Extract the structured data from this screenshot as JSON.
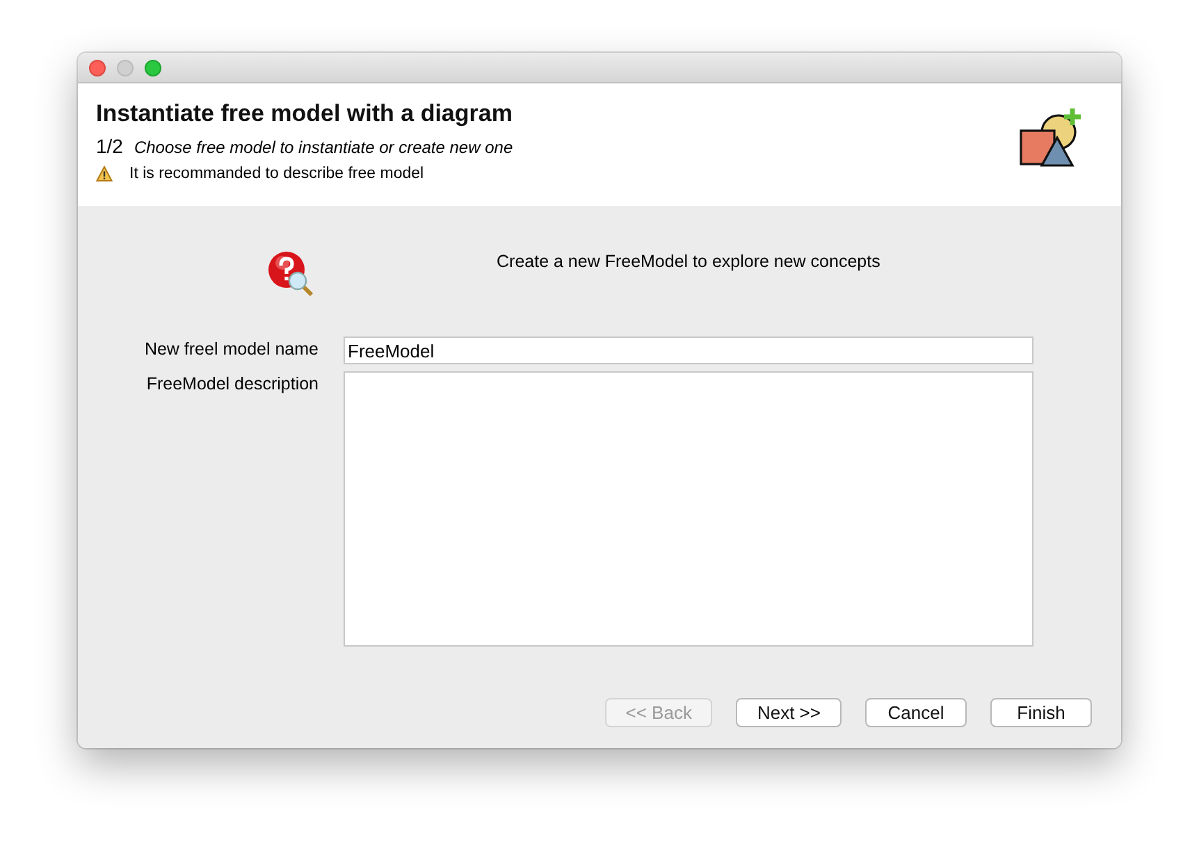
{
  "header": {
    "title": "Instantiate free model with a diagram",
    "step": "1/2",
    "subtitle": "Choose free model to instantiate or create new one",
    "warning": "It is recommanded to describe free model"
  },
  "message": "Create a new FreeModel to explore new concepts",
  "fields": [
    {
      "kind": "text",
      "label": "New freel model name",
      "value": "FreeModel"
    },
    {
      "kind": "textarea",
      "label": "FreeModel description"
    }
  ],
  "buttons": [
    {
      "label": "<< Back",
      "disabled": true
    },
    {
      "label": "Next >>",
      "disabled": false
    },
    {
      "label": "Cancel",
      "disabled": false
    },
    {
      "label": "Finish",
      "disabled": false
    }
  ]
}
